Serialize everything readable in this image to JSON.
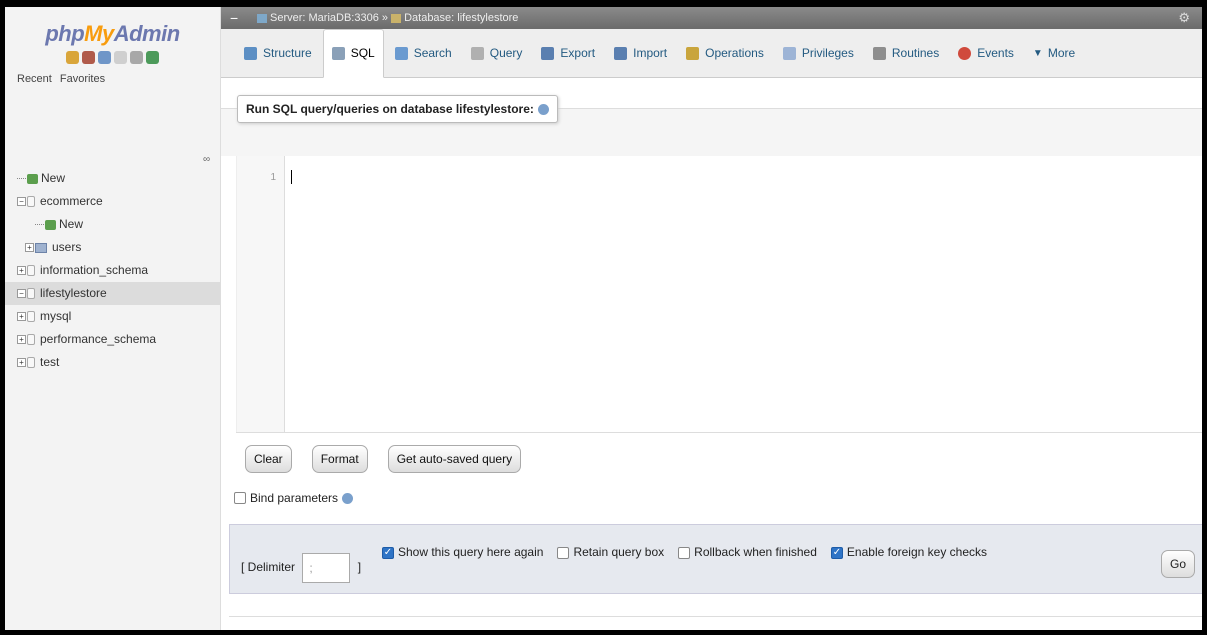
{
  "sidebar": {
    "logo": {
      "php": "php",
      "my": "My",
      "admin": "Admin"
    },
    "quick_icons": [
      "home-icon",
      "logout-icon",
      "help-icon",
      "docs-icon",
      "settings-icon",
      "reload-icon"
    ],
    "recent_label": "Recent",
    "favorites_label": "Favorites",
    "tree": [
      {
        "label": "New",
        "level": 0,
        "type": "new"
      },
      {
        "label": "ecommerce",
        "level": 0,
        "type": "db",
        "expanded": true
      },
      {
        "label": "New",
        "level": 1,
        "type": "new"
      },
      {
        "label": "users",
        "level": 1,
        "type": "table"
      },
      {
        "label": "information_schema",
        "level": 0,
        "type": "db"
      },
      {
        "label": "lifestylestore",
        "level": 0,
        "type": "db",
        "selected": true
      },
      {
        "label": "mysql",
        "level": 0,
        "type": "db"
      },
      {
        "label": "performance_schema",
        "level": 0,
        "type": "db"
      },
      {
        "label": "test",
        "level": 0,
        "type": "db"
      }
    ]
  },
  "breadcrumb": {
    "server": "Server: MariaDB:3306",
    "separator": "»",
    "database": "Database: lifestylestore"
  },
  "tabs": [
    {
      "label": "Structure",
      "icon": "structure-icon",
      "active": false,
      "color": "#5c8fc4"
    },
    {
      "label": "SQL",
      "icon": "sql-icon",
      "active": true,
      "color": "#8aa0b8"
    },
    {
      "label": "Search",
      "icon": "search-icon",
      "active": false,
      "color": "#6a9ad0"
    },
    {
      "label": "Query",
      "icon": "query-icon",
      "active": false,
      "color": "#b0b0b0"
    },
    {
      "label": "Export",
      "icon": "export-icon",
      "active": false,
      "color": "#5a7fb0"
    },
    {
      "label": "Import",
      "icon": "import-icon",
      "active": false,
      "color": "#5a7fb0"
    },
    {
      "label": "Operations",
      "icon": "wrench-icon",
      "active": false,
      "color": "#c9a53c"
    },
    {
      "label": "Privileges",
      "icon": "privileges-icon",
      "active": false,
      "color": "#9db4d6"
    },
    {
      "label": "Routines",
      "icon": "routines-icon",
      "active": false,
      "color": "#8e8e8e"
    },
    {
      "label": "Events",
      "icon": "clock-icon",
      "active": false,
      "color": "#d04a3c"
    },
    {
      "label": "More",
      "icon": "triangle-down-icon",
      "active": false,
      "color": "#444"
    }
  ],
  "query_panel": {
    "legend": "Run SQL query/queries on database lifestylestore:",
    "line_number": "1"
  },
  "buttons": {
    "clear": "Clear",
    "format": "Format",
    "autosaved": "Get auto-saved query"
  },
  "bind_parameters": "Bind parameters",
  "options": {
    "delimiter_label": "[ Delimiter",
    "delimiter_value": ";",
    "delimiter_close": "]",
    "show_query": {
      "label": "Show this query here again",
      "checked": true
    },
    "retain": {
      "label": "Retain query box",
      "checked": false
    },
    "rollback": {
      "label": "Rollback when finished",
      "checked": false
    },
    "foreign_keys": {
      "label": "Enable foreign key checks",
      "checked": true
    }
  },
  "go_label": "Go"
}
